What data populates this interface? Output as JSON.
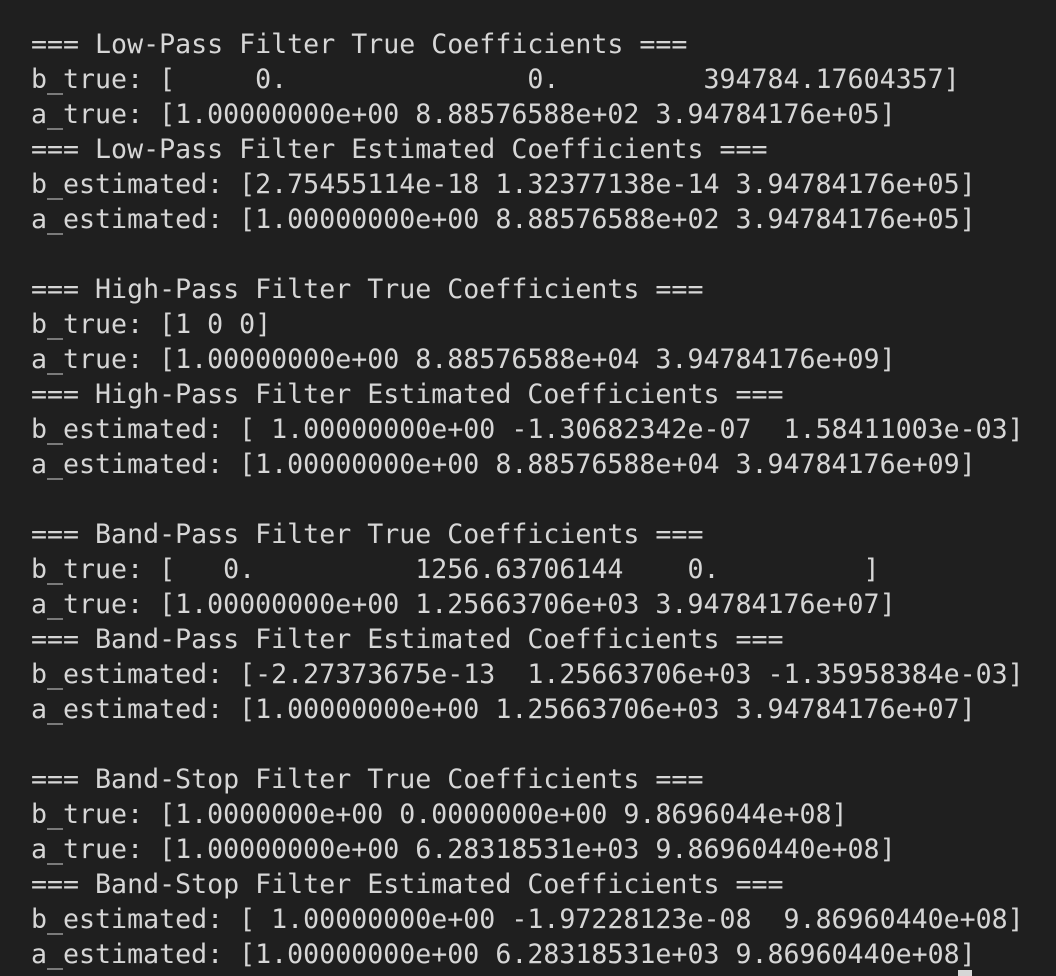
{
  "terminal": {
    "lines": [
      "=== Low-Pass Filter True Coefficients ===",
      "b_true: [     0.               0.         394784.17604357]",
      "a_true: [1.00000000e+00 8.88576588e+02 3.94784176e+05]",
      "=== Low-Pass Filter Estimated Coefficients ===",
      "b_estimated: [2.75455114e-18 1.32377138e-14 3.94784176e+05]",
      "a_estimated: [1.00000000e+00 8.88576588e+02 3.94784176e+05]",
      "",
      "=== High-Pass Filter True Coefficients ===",
      "b_true: [1 0 0]",
      "a_true: [1.00000000e+00 8.88576588e+04 3.94784176e+09]",
      "=== High-Pass Filter Estimated Coefficients ===",
      "b_estimated: [ 1.00000000e+00 -1.30682342e-07  1.58411003e-03]",
      "a_estimated: [1.00000000e+00 8.88576588e+04 3.94784176e+09]",
      "",
      "=== Band-Pass Filter True Coefficients ===",
      "b_true: [   0.          1256.63706144    0.         ]",
      "a_true: [1.00000000e+00 1.25663706e+03 3.94784176e+07]",
      "=== Band-Pass Filter Estimated Coefficients ===",
      "b_estimated: [-2.27373675e-13  1.25663706e+03 -1.35958384e-03]",
      "a_estimated: [1.00000000e+00 1.25663706e+03 3.94784176e+07]",
      "",
      "=== Band-Stop Filter True Coefficients ===",
      "b_true: [1.0000000e+00 0.0000000e+00 9.8696044e+08]",
      "a_true: [1.00000000e+00 6.28318531e+03 9.86960440e+08]",
      "=== Band-Stop Filter Estimated Coefficients ===",
      "b_estimated: [ 1.00000000e+00 -1.97228123e-08  9.86960440e+08]",
      "a_estimated: [1.00000000e+00 6.28318531e+03 9.86960440e+08]"
    ]
  }
}
